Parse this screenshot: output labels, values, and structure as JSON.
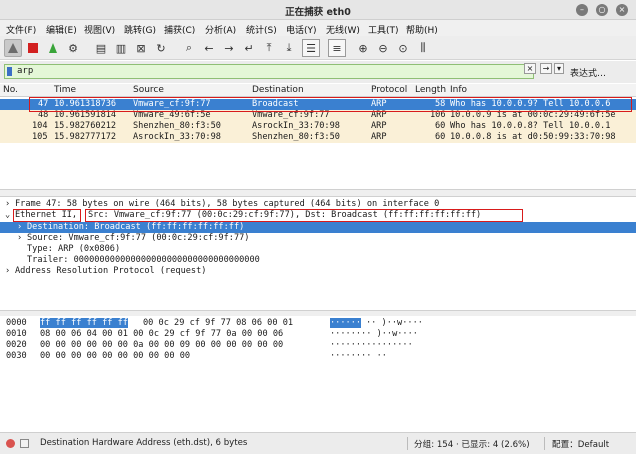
{
  "window": {
    "title": "正在捕获 eth0"
  },
  "menu": [
    "文件(F)",
    "编辑(E)",
    "视图(V)",
    "跳转(G)",
    "捕获(C)",
    "分析(A)",
    "统计(S)",
    "电话(Y)",
    "无线(W)",
    "工具(T)",
    "帮助(H)"
  ],
  "filter": {
    "value": "arp",
    "expression_label": "表达式…"
  },
  "packet_list": {
    "columns": [
      "No.",
      "Time",
      "Source",
      "Destination",
      "Protocol",
      "Length",
      "Info"
    ],
    "rows": [
      {
        "no": "47",
        "time": "10.961318736",
        "source": "Vmware_cf:9f:77",
        "destination": "Broadcast",
        "protocol": "ARP",
        "length": "58",
        "info": "Who has 10.0.0.9? Tell 10.0.0.6"
      },
      {
        "no": "48",
        "time": "10.961591814",
        "source": "Vmware_49:6f:5e",
        "destination": "Vmware_cf:9f:77",
        "protocol": "ARP",
        "length": "106",
        "info": "10.0.0.9 is at 00:0c:29:49:6f:5e"
      },
      {
        "no": "104",
        "time": "15.982760212",
        "source": "Shenzhen_80:f3:50",
        "destination": "AsrockIn_33:70:98",
        "protocol": "ARP",
        "length": "60",
        "info": "Who has 10.0.0.8? Tell 10.0.0.1"
      },
      {
        "no": "105",
        "time": "15.982777172",
        "source": "AsrockIn_33:70:98",
        "destination": "Shenzhen_80:f3:50",
        "protocol": "ARP",
        "length": "60",
        "info": "10.0.0.8 is at d0:50:99:33:70:98"
      }
    ]
  },
  "details": {
    "frame": "Frame 47: 58 bytes on wire (464 bits), 58 bytes captured (464 bits) on interface 0",
    "ethernet_label": "Ethernet II,",
    "ethernet_rest": "Src: Vmware_cf:9f:77 (00:0c:29:cf:9f:77), Dst: Broadcast (ff:ff:ff:ff:ff:ff)",
    "destination": "Destination: Broadcast (ff:ff:ff:ff:ff:ff)",
    "source": "Source: Vmware_cf:9f:77 (00:0c:29:cf:9f:77)",
    "type": "Type: ARP (0x0806)",
    "trailer": "Trailer: 000000000000000000000000000000000000",
    "arp": "Address Resolution Protocol (request)"
  },
  "hex": [
    {
      "offset": "0000",
      "hl": "ff ff ff ff ff ff",
      "bytes": "00 0c  29 cf 9f 77 08 06 00 01",
      "ascii_hl": "······",
      "ascii": "·· )··w····"
    },
    {
      "offset": "0010",
      "hl": "",
      "bytes": "08 00 06 04 00 01 00 0c  29 cf 9f 77 0a 00 00 06",
      "ascii_hl": "",
      "ascii": "········ )··w····"
    },
    {
      "offset": "0020",
      "hl": "",
      "bytes": "00 00 00 00 00 00 0a 00  00 09 00 00 00 00 00 00",
      "ascii_hl": "",
      "ascii": "················"
    },
    {
      "offset": "0030",
      "hl": "",
      "bytes": "00 00 00 00 00 00 00 00  00 00",
      "ascii_hl": "",
      "ascii": "········ ··"
    }
  ],
  "status": {
    "field": "Destination Hardware Address (eth.dst), 6 bytes",
    "packets": "分组: 154 · 已显示: 4 (2.6%)",
    "profile": "配置：Default"
  },
  "colors": {
    "selection": "#3a80d0",
    "arp_row": "#faf0d7",
    "filter_ok": "#e4f7d7",
    "annotation": "#d81b1b"
  }
}
